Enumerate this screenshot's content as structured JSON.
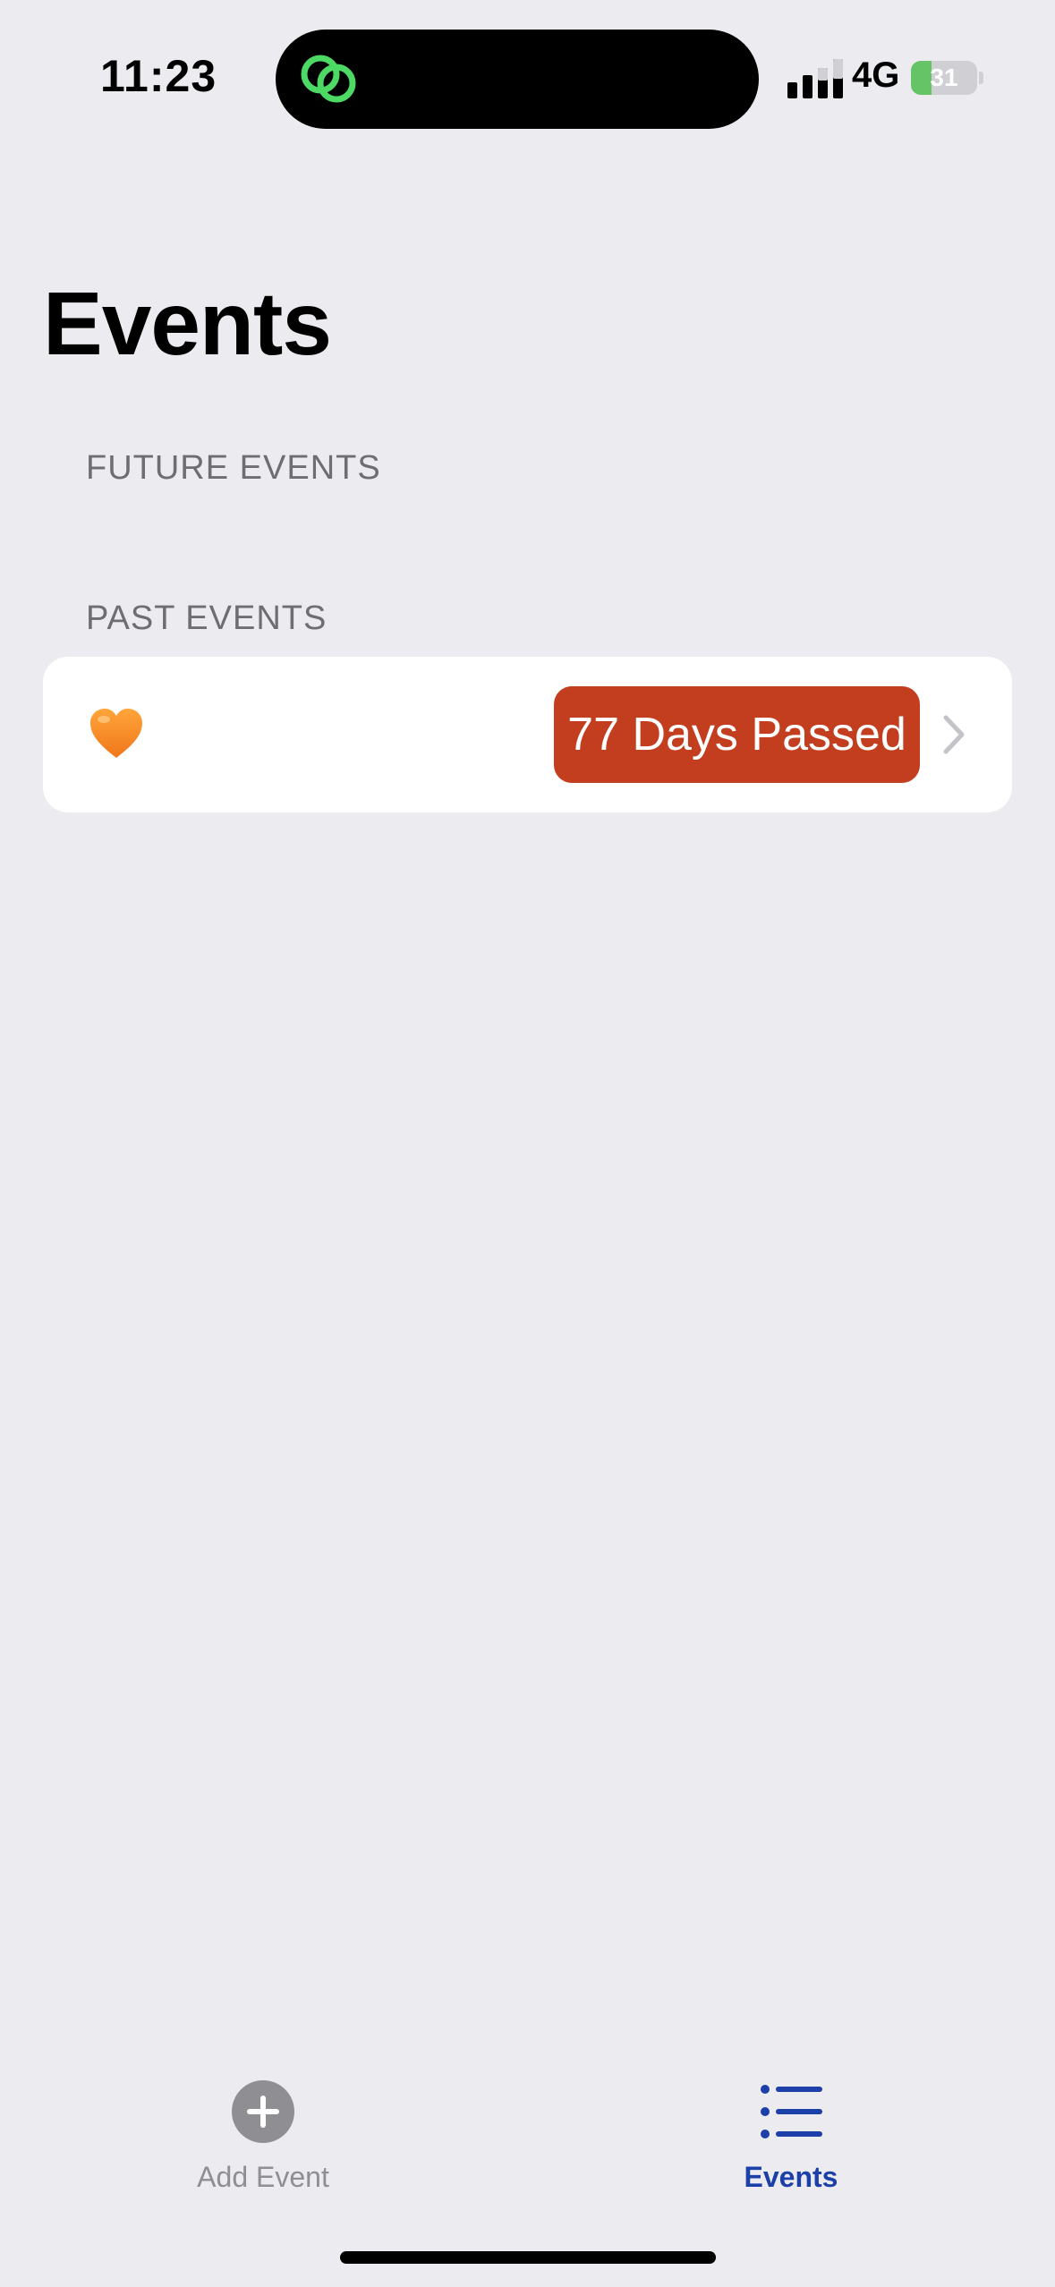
{
  "status_bar": {
    "time": "11:23",
    "network": "4G",
    "battery_percent": 31,
    "battery_label": "31",
    "signal_bars_filled": 2,
    "signal_bars_total": 4
  },
  "page": {
    "title": "Events"
  },
  "sections": {
    "future": {
      "header": "FUTURE EVENTS",
      "items": []
    },
    "past": {
      "header": "PAST EVENTS",
      "items": [
        {
          "emoji": "orange-heart",
          "badge": "77 Days Passed"
        }
      ]
    }
  },
  "tab_bar": {
    "add": {
      "label": "Add Event",
      "icon": "plus-circle-icon"
    },
    "events": {
      "label": "Events",
      "icon": "list-icon",
      "selected": true
    }
  },
  "colors": {
    "background": "#EBEBF0",
    "badge": "#C33E1E",
    "tab_selected": "#1C3FA8",
    "tab_inactive": "#8E8E93",
    "island_icon": "#4CD964",
    "battery_fill": "#65C466"
  }
}
